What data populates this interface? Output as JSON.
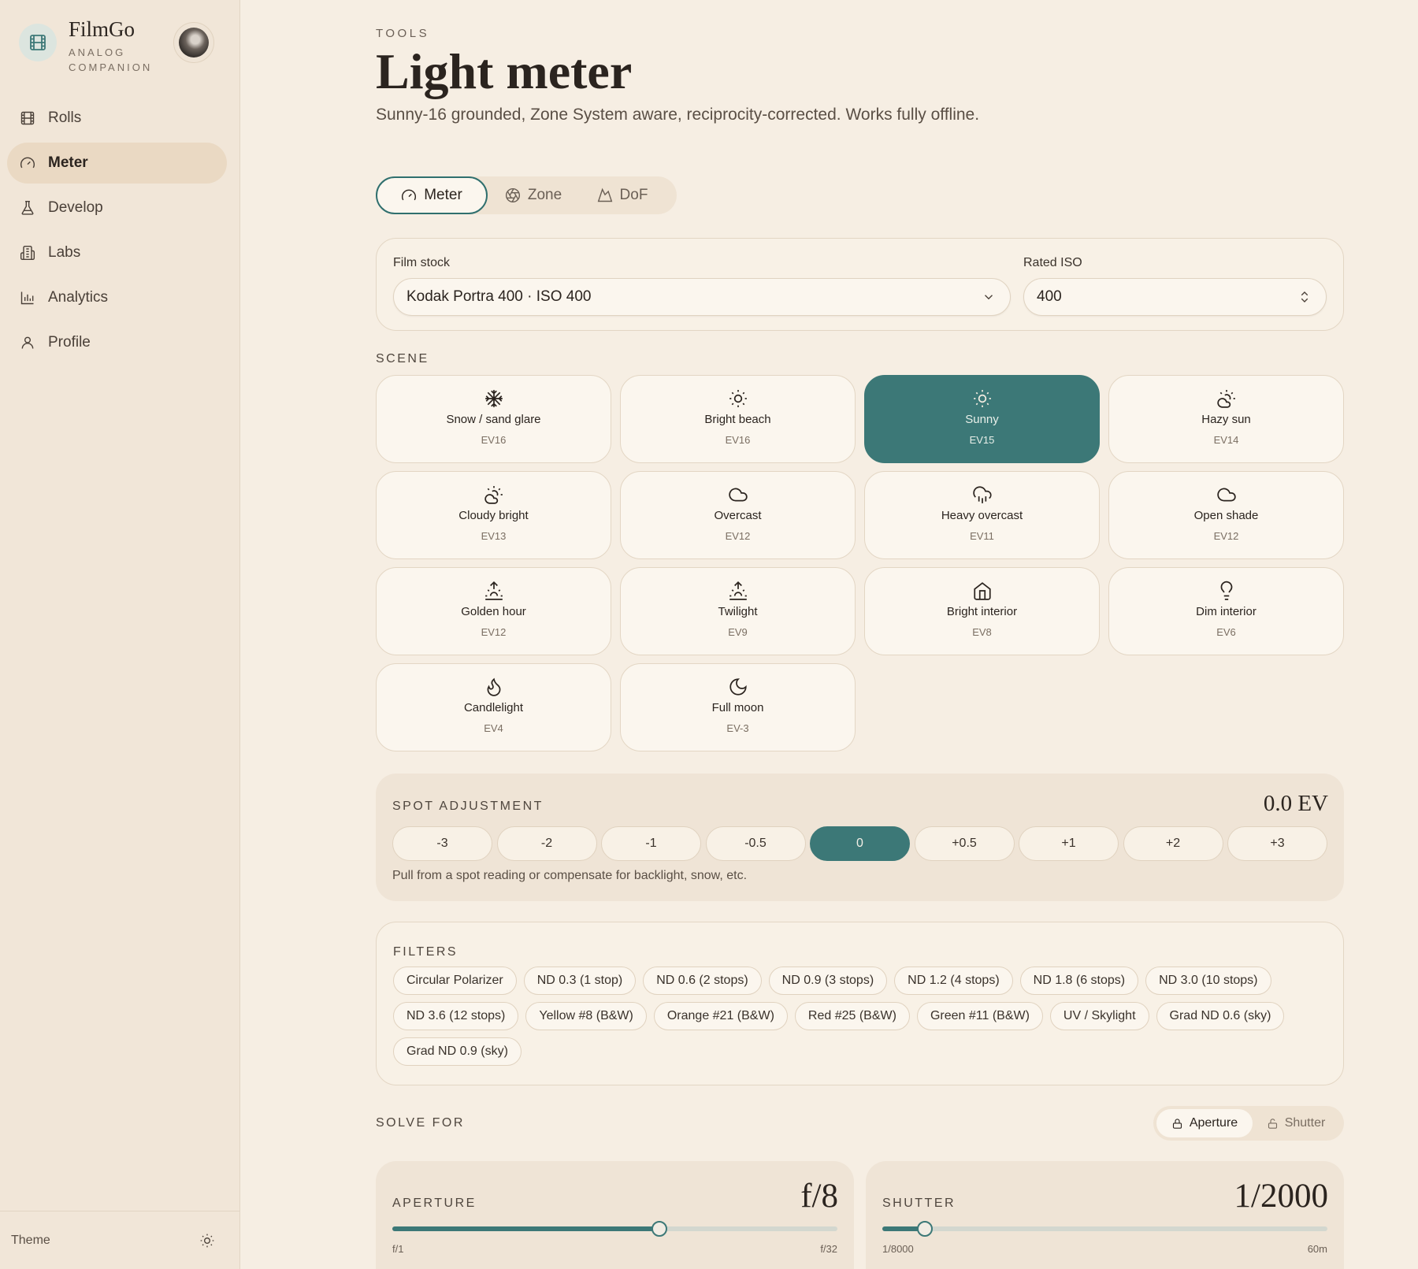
{
  "brand": {
    "name": "FilmGo",
    "subtitle": "ANALOG COMPANION"
  },
  "sidebar": {
    "items": [
      {
        "label": "Rolls",
        "icon": "film-icon",
        "active": false
      },
      {
        "label": "Meter",
        "icon": "gauge-icon",
        "active": true
      },
      {
        "label": "Develop",
        "icon": "flask-icon",
        "active": false
      },
      {
        "label": "Labs",
        "icon": "building-icon",
        "active": false
      },
      {
        "label": "Analytics",
        "icon": "bar-chart-icon",
        "active": false
      },
      {
        "label": "Profile",
        "icon": "user-icon",
        "active": false
      }
    ],
    "theme_label": "Theme"
  },
  "header": {
    "eyebrow": "TOOLS",
    "title": "Light meter",
    "description": "Sunny-16 grounded, Zone System aware, reciprocity-corrected. Works fully offline."
  },
  "mode_tabs": [
    {
      "label": "Meter",
      "active": true
    },
    {
      "label": "Zone",
      "active": false
    },
    {
      "label": "DoF",
      "active": false
    }
  ],
  "film": {
    "stock_label": "Film stock",
    "stock_value": "Kodak Portra 400 · ISO 400",
    "iso_label": "Rated ISO",
    "iso_value": "400"
  },
  "scene": {
    "label": "SCENE",
    "items": [
      {
        "name": "Snow / sand glare",
        "ev": "EV16",
        "icon": "snowflake-icon",
        "active": false
      },
      {
        "name": "Bright beach",
        "ev": "EV16",
        "icon": "sun-icon",
        "active": false
      },
      {
        "name": "Sunny",
        "ev": "EV15",
        "icon": "sun-icon",
        "active": true
      },
      {
        "name": "Hazy sun",
        "ev": "EV14",
        "icon": "sun-cloud-icon",
        "active": false
      },
      {
        "name": "Cloudy bright",
        "ev": "EV13",
        "icon": "sun-cloud-icon",
        "active": false
      },
      {
        "name": "Overcast",
        "ev": "EV12",
        "icon": "cloud-icon",
        "active": false
      },
      {
        "name": "Heavy overcast",
        "ev": "EV11",
        "icon": "cloud-rain-icon",
        "active": false
      },
      {
        "name": "Open shade",
        "ev": "EV12",
        "icon": "cloud-icon",
        "active": false
      },
      {
        "name": "Golden hour",
        "ev": "EV12",
        "icon": "sunrise-icon",
        "active": false
      },
      {
        "name": "Twilight",
        "ev": "EV9",
        "icon": "sunset-icon",
        "active": false
      },
      {
        "name": "Bright interior",
        "ev": "EV8",
        "icon": "home-icon",
        "active": false
      },
      {
        "name": "Dim interior",
        "ev": "EV6",
        "icon": "lightbulb-icon",
        "active": false
      },
      {
        "name": "Candlelight",
        "ev": "EV4",
        "icon": "flame-icon",
        "active": false
      },
      {
        "name": "Full moon",
        "ev": "EV-3",
        "icon": "moon-icon",
        "active": false
      }
    ]
  },
  "spot": {
    "label": "SPOT ADJUSTMENT",
    "value": "0.0 EV",
    "steps": [
      "-3",
      "-2",
      "-1",
      "-0.5",
      "0",
      "+0.5",
      "+1",
      "+2",
      "+3"
    ],
    "active_step": "0",
    "hint": "Pull from a spot reading or compensate for backlight, snow, etc."
  },
  "filters": {
    "label": "FILTERS",
    "items": [
      "Circular Polarizer",
      "ND 0.3 (1 stop)",
      "ND 0.6 (2 stops)",
      "ND 0.9 (3 stops)",
      "ND 1.2 (4 stops)",
      "ND 1.8 (6 stops)",
      "ND 3.0 (10 stops)",
      "ND 3.6 (12 stops)",
      "Yellow #8 (B&W)",
      "Orange #21 (B&W)",
      "Red #25 (B&W)",
      "Green #11 (B&W)",
      "UV / Skylight",
      "Grad ND 0.6 (sky)",
      "Grad ND 0.9 (sky)"
    ]
  },
  "solve": {
    "label": "SOLVE FOR",
    "options": [
      {
        "label": "Aperture",
        "active": true
      },
      {
        "label": "Shutter",
        "active": false
      }
    ]
  },
  "aperture": {
    "label": "APERTURE",
    "value": "f/8",
    "min": "f/1",
    "max": "f/32",
    "position": 0.6
  },
  "shutter": {
    "label": "SHUTTER",
    "value": "1/2000",
    "min": "1/8000",
    "max": "60m",
    "position": 0.095
  },
  "colors": {
    "accent": "#3c7877",
    "background": "#f6eee3",
    "sidebar": "#f1e6d8"
  }
}
